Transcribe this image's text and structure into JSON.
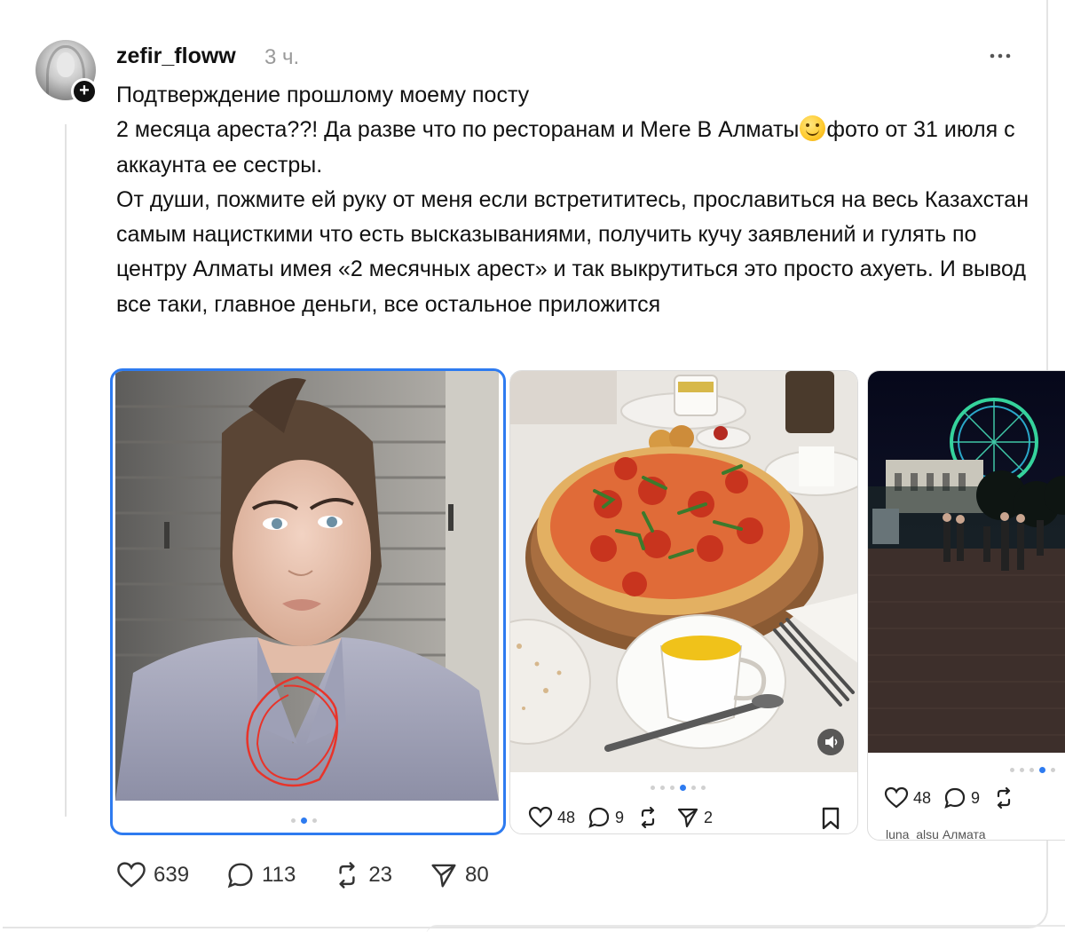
{
  "post": {
    "author": "zefir_floww",
    "time": "3 ч.",
    "lines": [
      "Подтверждение прошлому моему посту",
      "2 месяца ареста??! Да разве что по ресторанам и Меге В Алматы",
      "фото от 31 июля с аккаунта ее сестры.",
      "От души, пожмите ей руку от меня если встретититесь, прославиться на весь Казахстан самым нацисткими что есть высказываниями, получить кучу заявлений и гулять по центру Алматы имея «2 месячных арест» и так выкрутиться это просто ахуеть. И вывод все таки, главное деньги, все остальное приложится"
    ],
    "emoji_icon": "smiling-face-emoji",
    "stats": {
      "likes": "639",
      "replies": "113",
      "reposts": "23",
      "shares": "80"
    }
  },
  "media": [
    {
      "kind": "portrait-photo",
      "dots_total": 3,
      "dots_active": 2
    },
    {
      "kind": "restaurant-pizza-photo",
      "dots_total": 6,
      "dots_active": 4,
      "likes": "48",
      "replies": "9",
      "shares": "2"
    },
    {
      "kind": "night-ferris-wheel-photo",
      "likes": "48",
      "replies": "9",
      "caption": "luna_alsu Алмата"
    }
  ],
  "colors": {
    "accent": "#2e7bf0",
    "text": "#111111",
    "muted": "#9a9a9a",
    "annotation": "#e8342a"
  }
}
